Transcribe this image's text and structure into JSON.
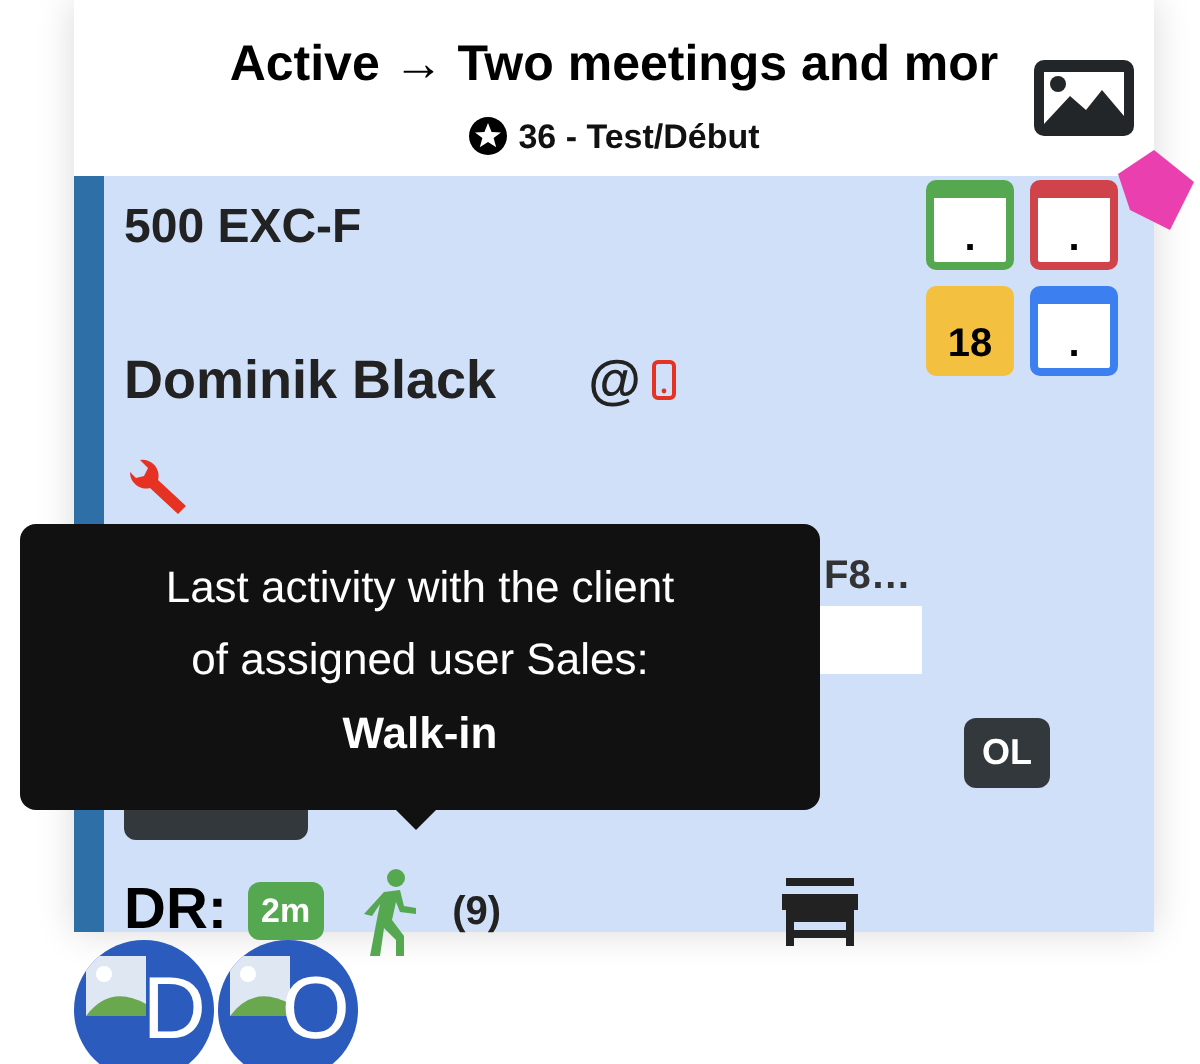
{
  "header": {
    "title": "Active → Two meetings and mor",
    "subtitle": "36 - Test/Début"
  },
  "card": {
    "code": "500 EXC-F",
    "client": "Dominik Black",
    "email_symbol": "@",
    "calendars": [
      {
        "label": ".",
        "color": "#55a84f"
      },
      {
        "label": ".",
        "color": "#d0434a"
      },
      {
        "label": "18",
        "color": "#f3c040"
      },
      {
        "label": ".",
        "color": "#3b7ff0"
      }
    ],
    "product_line": "F8…",
    "badge_right": "OL",
    "dr_label": "DR:",
    "dr_badge": "2m",
    "dr_count": "(9)"
  },
  "tooltip": {
    "line_1": "Last activity with the client",
    "line_2": "of assigned user Sales:",
    "line_3": "Walk-in"
  },
  "avatars": [
    {
      "initial": "D"
    },
    {
      "initial": "O"
    }
  ]
}
